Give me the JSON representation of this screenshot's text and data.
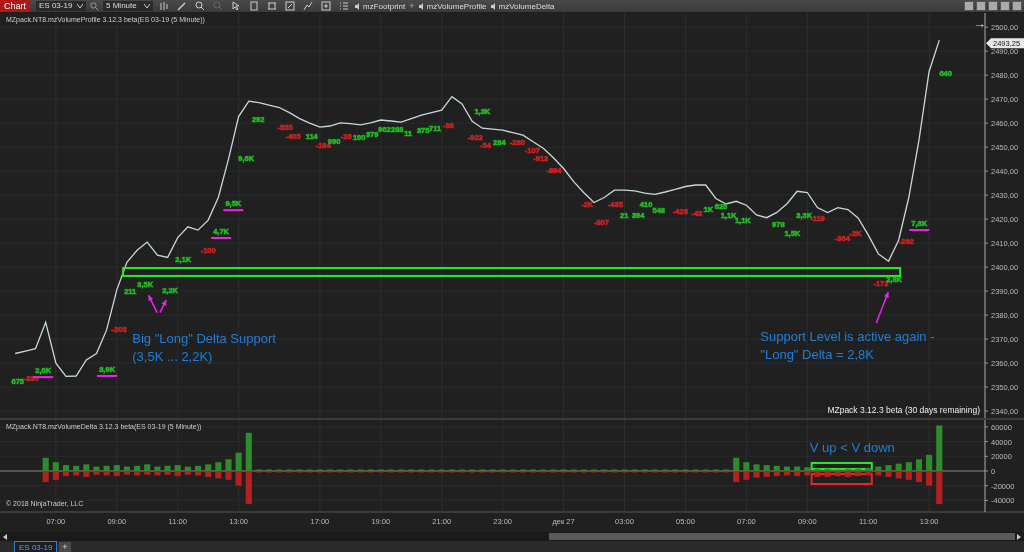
{
  "toolbar": {
    "tab_label": "Chart",
    "instrument": "ES 03-19",
    "interval": "5 Minute",
    "indicators": [
      {
        "kind": "indicator",
        "label": "mzFootprint"
      },
      {
        "kind": "add",
        "label": "+"
      },
      {
        "kind": "indicator",
        "label": "mzVolumeProfile"
      },
      {
        "kind": "indicator",
        "label": "mzVolumeDelta"
      }
    ]
  },
  "price_panel": {
    "title": "MZpack.NT8.mzVolumeProfile 3.12.3 beta(ES 03-19 (5 Minute))",
    "arrow": "→",
    "license_note": "MZpack 3.12.3 beta  (30 days remaining)",
    "last_price": "2493,25",
    "chart_data": {
      "type": "line",
      "grid": true,
      "ylim": [
        2337.1,
        2505.9
      ],
      "yticks": [
        {
          "value": 2340,
          "label": "2340,00"
        },
        {
          "value": 2350,
          "label": "2350,00"
        },
        {
          "value": 2360,
          "label": "2360,00"
        },
        {
          "value": 2370,
          "label": "2370,00"
        },
        {
          "value": 2380,
          "label": "2380,00"
        },
        {
          "value": 2390,
          "label": "2390,00"
        },
        {
          "value": 2400,
          "label": "2400,00"
        },
        {
          "value": 2410,
          "label": "2410,00"
        },
        {
          "value": 2420,
          "label": "2420,00"
        },
        {
          "value": 2430,
          "label": "2430,00"
        },
        {
          "value": 2440,
          "label": "2440,00"
        },
        {
          "value": 2450,
          "label": "2450,00"
        },
        {
          "value": 2460,
          "label": "2460,00"
        },
        {
          "value": 2470,
          "label": "2470,00"
        },
        {
          "value": 2480,
          "label": "2480,00"
        },
        {
          "value": 2490,
          "label": "2490,00"
        },
        {
          "value": 2500,
          "label": "2500,00"
        }
      ],
      "series": [
        {
          "color": "#c8d8d8",
          "values": [
            null,
            2364,
            2365,
            2366,
            2377,
            2360,
            2354.5,
            2354.6,
            2361.3,
            2364,
            2373.8,
            2390.5,
            2402,
            2407,
            2410.4,
            2405,
            2404,
            2412.3,
            2416.8,
            2415.4,
            2419.6,
            2429,
            2445,
            2462.7,
            2469.2,
            2468.5,
            2467.5,
            2466.5,
            2464.4,
            2461.9,
            2460,
            2458.3,
            2458.8,
            2460.1,
            2459.8,
            2459.3,
            2460.1,
            2461.3,
            2460.9,
            2460.4,
            2461.9,
            2463.3,
            2464.4,
            2465.4,
            2471,
            2468,
            2460.7,
            2457.9,
            2457.5,
            2457.1,
            2456,
            2455,
            2452.2,
            2449.5,
            2445.6,
            2441.1,
            2435.6,
            2431,
            2426.9,
            2429,
            2432.1,
            2432.1,
            2431.8,
            2430.8,
            2430.3,
            2431.3,
            2432.4,
            2433.6,
            2434.2,
            2434.2,
            2428.6,
            2426.3,
            2427.4,
            2425.8,
            2421.7,
            2420.6,
            2422.8,
            2426.4,
            2431.6,
            2431.1,
            2424.8,
            2422.7,
            2424.8,
            2424,
            2420.5,
            2413.4,
            2405.5,
            2402.4,
            2411.3,
            2429,
            2453,
            2481.5,
            2494.6,
            null,
            null,
            null,
            null
          ]
        }
      ]
    },
    "delta_labels": [
      {
        "text": "675",
        "color": "#22bb22",
        "underlined": false
      },
      {
        "text": "-330",
        "color": "#cc2222",
        "underlined": false
      },
      {
        "text": "2,6K",
        "color": "#22bb22",
        "underlined": true
      },
      {
        "text": "3,9K",
        "color": "#22bb22",
        "underlined": true
      },
      {
        "text": "-203",
        "color": "#cc2222",
        "underlined": false
      },
      {
        "text": "211",
        "color": "#22bb22",
        "underlined": false
      },
      {
        "text": "3,5K",
        "color": "#22bb22",
        "underlined": false
      },
      {
        "text": "2,2K",
        "color": "#22bb22",
        "underlined": false
      },
      {
        "text": "2,1K",
        "color": "#22bb22",
        "underlined": false
      },
      {
        "text": "-100",
        "color": "#cc2222",
        "underlined": false
      },
      {
        "text": "4,7K",
        "color": "#22bb22",
        "underlined": true
      },
      {
        "text": "9,5K",
        "color": "#22bb22",
        "underlined": true
      },
      {
        "text": "9,6K",
        "color": "#22bb22",
        "underlined": false
      },
      {
        "text": "292",
        "color": "#22bb22",
        "underlined": false
      },
      {
        "text": "-555",
        "color": "#cc2222",
        "underlined": false
      },
      {
        "text": "-405",
        "color": "#cc2222",
        "underlined": false
      },
      {
        "text": "114",
        "color": "#22bb22",
        "underlined": false
      },
      {
        "text": "-184",
        "color": "#cc2222",
        "underlined": false
      },
      {
        "text": "990",
        "color": "#22bb22",
        "underlined": false
      },
      {
        "text": "-26",
        "color": "#cc2222",
        "underlined": false
      },
      {
        "text": "100",
        "color": "#22bb22",
        "underlined": false
      },
      {
        "text": "379",
        "color": "#22bb22",
        "underlined": false
      },
      {
        "text": "962",
        "color": "#22bb22",
        "underlined": false
      },
      {
        "text": "288",
        "color": "#22bb22",
        "underlined": false
      },
      {
        "text": "11",
        "color": "#22bb22",
        "underlined": false
      },
      {
        "text": "375",
        "color": "#22bb22",
        "underlined": false
      },
      {
        "text": "711",
        "color": "#22bb22",
        "underlined": false
      },
      {
        "text": "-88",
        "color": "#cc2222",
        "underlined": false
      },
      {
        "text": "1,3K",
        "color": "#22bb22",
        "underlined": false
      },
      {
        "text": "-922",
        "color": "#cc2222",
        "underlined": false
      },
      {
        "text": "-54",
        "color": "#cc2222",
        "underlined": false
      },
      {
        "text": "284",
        "color": "#22bb22",
        "underlined": false
      },
      {
        "text": "-280",
        "color": "#cc2222",
        "underlined": false
      },
      {
        "text": "-107",
        "color": "#cc2222",
        "underlined": false
      },
      {
        "text": "-913",
        "color": "#cc2222",
        "underlined": false
      },
      {
        "text": "-884",
        "color": "#cc2222",
        "underlined": false
      },
      {
        "text": "-2K",
        "color": "#cc2222",
        "underlined": false
      },
      {
        "text": "-807",
        "color": "#cc2222",
        "underlined": false
      },
      {
        "text": "-435",
        "color": "#cc2222",
        "underlined": false
      },
      {
        "text": "21",
        "color": "#22bb22",
        "underlined": false
      },
      {
        "text": "394",
        "color": "#22bb22",
        "underlined": false
      },
      {
        "text": "410",
        "color": "#22bb22",
        "underlined": false
      },
      {
        "text": "548",
        "color": "#22bb22",
        "underlined": false
      },
      {
        "text": "-426",
        "color": "#cc2222",
        "underlined": false
      },
      {
        "text": "-43",
        "color": "#cc2222",
        "underlined": false
      },
      {
        "text": "1K",
        "color": "#22bb22",
        "underlined": false
      },
      {
        "text": "625",
        "color": "#22bb22",
        "underlined": false
      },
      {
        "text": "1,1K",
        "color": "#22bb22",
        "underlined": false
      },
      {
        "text": "1,1K",
        "color": "#22bb22",
        "underlined": false
      },
      {
        "text": "978",
        "color": "#22bb22",
        "underlined": false
      },
      {
        "text": "1,5K",
        "color": "#22bb22",
        "underlined": false
      },
      {
        "text": "3,3K",
        "color": "#22bb22",
        "underlined": false
      },
      {
        "text": "-119",
        "color": "#cc2222",
        "underlined": false
      },
      {
        "text": "-364",
        "color": "#cc2222",
        "underlined": false
      },
      {
        "text": "-2K",
        "color": "#cc2222",
        "underlined": false
      },
      {
        "text": "-172",
        "color": "#cc2222",
        "underlined": false
      },
      {
        "text": "2,8K",
        "color": "#22bb22",
        "underlined": false
      },
      {
        "text": "-292",
        "color": "#cc2222",
        "underlined": false
      },
      {
        "text": "7,8K",
        "color": "#22bb22",
        "underlined": true
      },
      {
        "text": "640",
        "color": "#22bb22",
        "underlined": false
      }
    ],
    "drawings": [
      {
        "kind": "rectangle",
        "color": "#22ee22"
      },
      {
        "kind": "arrow",
        "color": "#ee22ee"
      },
      {
        "kind": "arrow",
        "color": "#ee22ee"
      },
      {
        "kind": "arrow",
        "color": "#ee22ee"
      },
      {
        "kind": "text",
        "text": "Big \"Long\" Delta Support",
        "color": "#1e7fd8"
      },
      {
        "kind": "text",
        "text": "(3,5K ... 2,2K)",
        "color": "#1e7fd8"
      },
      {
        "kind": "text",
        "text": "Support Level is active again -",
        "color": "#1e7fd8"
      },
      {
        "kind": "text",
        "text": "\"Long\" Delta = 2,8K",
        "color": "#1e7fd8"
      }
    ]
  },
  "delta_panel": {
    "title": "MZpack.NT8.mzVolumeDelta 3.12.3 beta(ES 03-19 (5 Minute))",
    "copyright": "© 2018 NinjaTrader, LLC",
    "chart_data": {
      "type": "bar",
      "stacked": true,
      "grid": true,
      "ylim": [
        -55800,
        69400
      ],
      "ref_lines": [
        {
          "axis": "y",
          "value": 0
        }
      ],
      "categories": [
        null,
        null,
        null,
        null,
        null,
        "07:00",
        null,
        null,
        null,
        null,
        null,
        "09:00",
        null,
        null,
        null,
        null,
        null,
        "11:00",
        null,
        null,
        null,
        null,
        null,
        "13:00",
        null,
        null,
        null,
        null,
        null,
        null,
        null,
        "17:00",
        null,
        null,
        null,
        null,
        null,
        "19:00",
        null,
        null,
        null,
        null,
        null,
        "21:00",
        null,
        null,
        null,
        null,
        null,
        "23:00",
        null,
        null,
        null,
        null,
        null,
        "дек 27",
        null,
        null,
        null,
        null,
        null,
        "03:00",
        null,
        null,
        null,
        null,
        null,
        "05:00",
        null,
        null,
        null,
        null,
        null,
        "07:00",
        null,
        null,
        null,
        null,
        null,
        "09:00",
        null,
        null,
        null,
        null,
        null,
        "11:00",
        null,
        null,
        null,
        null,
        null,
        "13:00",
        null,
        null,
        null,
        null,
        null
      ],
      "yticks": [
        60000,
        40000,
        20000,
        0,
        -20000,
        -40000
      ],
      "series": [
        {
          "color": "#2e8b2e",
          "values": [
            null,
            null,
            null,
            null,
            18000,
            12000,
            8000,
            7000,
            9000,
            6000,
            7000,
            8000,
            6000,
            7000,
            9000,
            6000,
            7000,
            8000,
            6000,
            7000,
            9000,
            12000,
            16000,
            25000,
            52000,
            2000,
            2000,
            2000,
            2000,
            2000,
            2000,
            2000,
            2000,
            2000,
            2000,
            2000,
            2000,
            2000,
            2000,
            2000,
            2000,
            2000,
            2000,
            2000,
            2000,
            2000,
            2000,
            2000,
            2000,
            2000,
            2000,
            2000,
            2000,
            2000,
            2000,
            2000,
            2000,
            2000,
            2000,
            2000,
            2000,
            2000,
            2000,
            2000,
            2000,
            2000,
            2000,
            2000,
            2000,
            2000,
            2000,
            2000,
            18000,
            12000,
            9000,
            8000,
            7000,
            6000,
            6000,
            5000,
            3000,
            3000,
            2000,
            3000,
            3000,
            4000,
            6000,
            8000,
            10000,
            12000,
            16000,
            22000,
            62000,
            null,
            null,
            null,
            null
          ]
        },
        {
          "color": "#b82020",
          "values": [
            null,
            null,
            null,
            null,
            -15000,
            -12000,
            -7000,
            -6000,
            -8000,
            -5000,
            -6000,
            -7000,
            -5000,
            -6000,
            -5000,
            -6000,
            -5000,
            -7000,
            -5000,
            -6000,
            -8000,
            -10000,
            -12000,
            -20000,
            -45000,
            -2000,
            -2000,
            -2000,
            -2000,
            -2000,
            -2000,
            -2000,
            -2000,
            -2000,
            -2000,
            -2000,
            -2000,
            -2000,
            -2000,
            -2000,
            -2000,
            -2000,
            -2000,
            -2000,
            -2000,
            -2000,
            -2000,
            -2000,
            -2000,
            -2000,
            -2000,
            -2000,
            -2000,
            -2000,
            -2000,
            -2000,
            -2000,
            -2000,
            -2000,
            -2000,
            -2000,
            -2000,
            -2000,
            -2000,
            -2000,
            -2000,
            -2000,
            -2000,
            -2000,
            -2000,
            -2000,
            -2000,
            -15000,
            -12000,
            -9000,
            -8000,
            -7000,
            -6000,
            -7000,
            -6000,
            -8000,
            -8000,
            -7000,
            -8000,
            -7000,
            -6000,
            -6000,
            -8000,
            -10000,
            -12000,
            -15000,
            -20000,
            -45000,
            null,
            null,
            null,
            null
          ]
        }
      ]
    },
    "drawings": [
      {
        "kind": "rectangle",
        "color": "#22ee22"
      },
      {
        "kind": "rectangle",
        "color": "#ee2222"
      },
      {
        "kind": "text",
        "text": "V up < V down",
        "color": "#1e7fd8"
      }
    ]
  },
  "footer": {
    "tabs": [
      {
        "label": "ES 03-19",
        "selected": true
      }
    ],
    "add_label": "+"
  }
}
